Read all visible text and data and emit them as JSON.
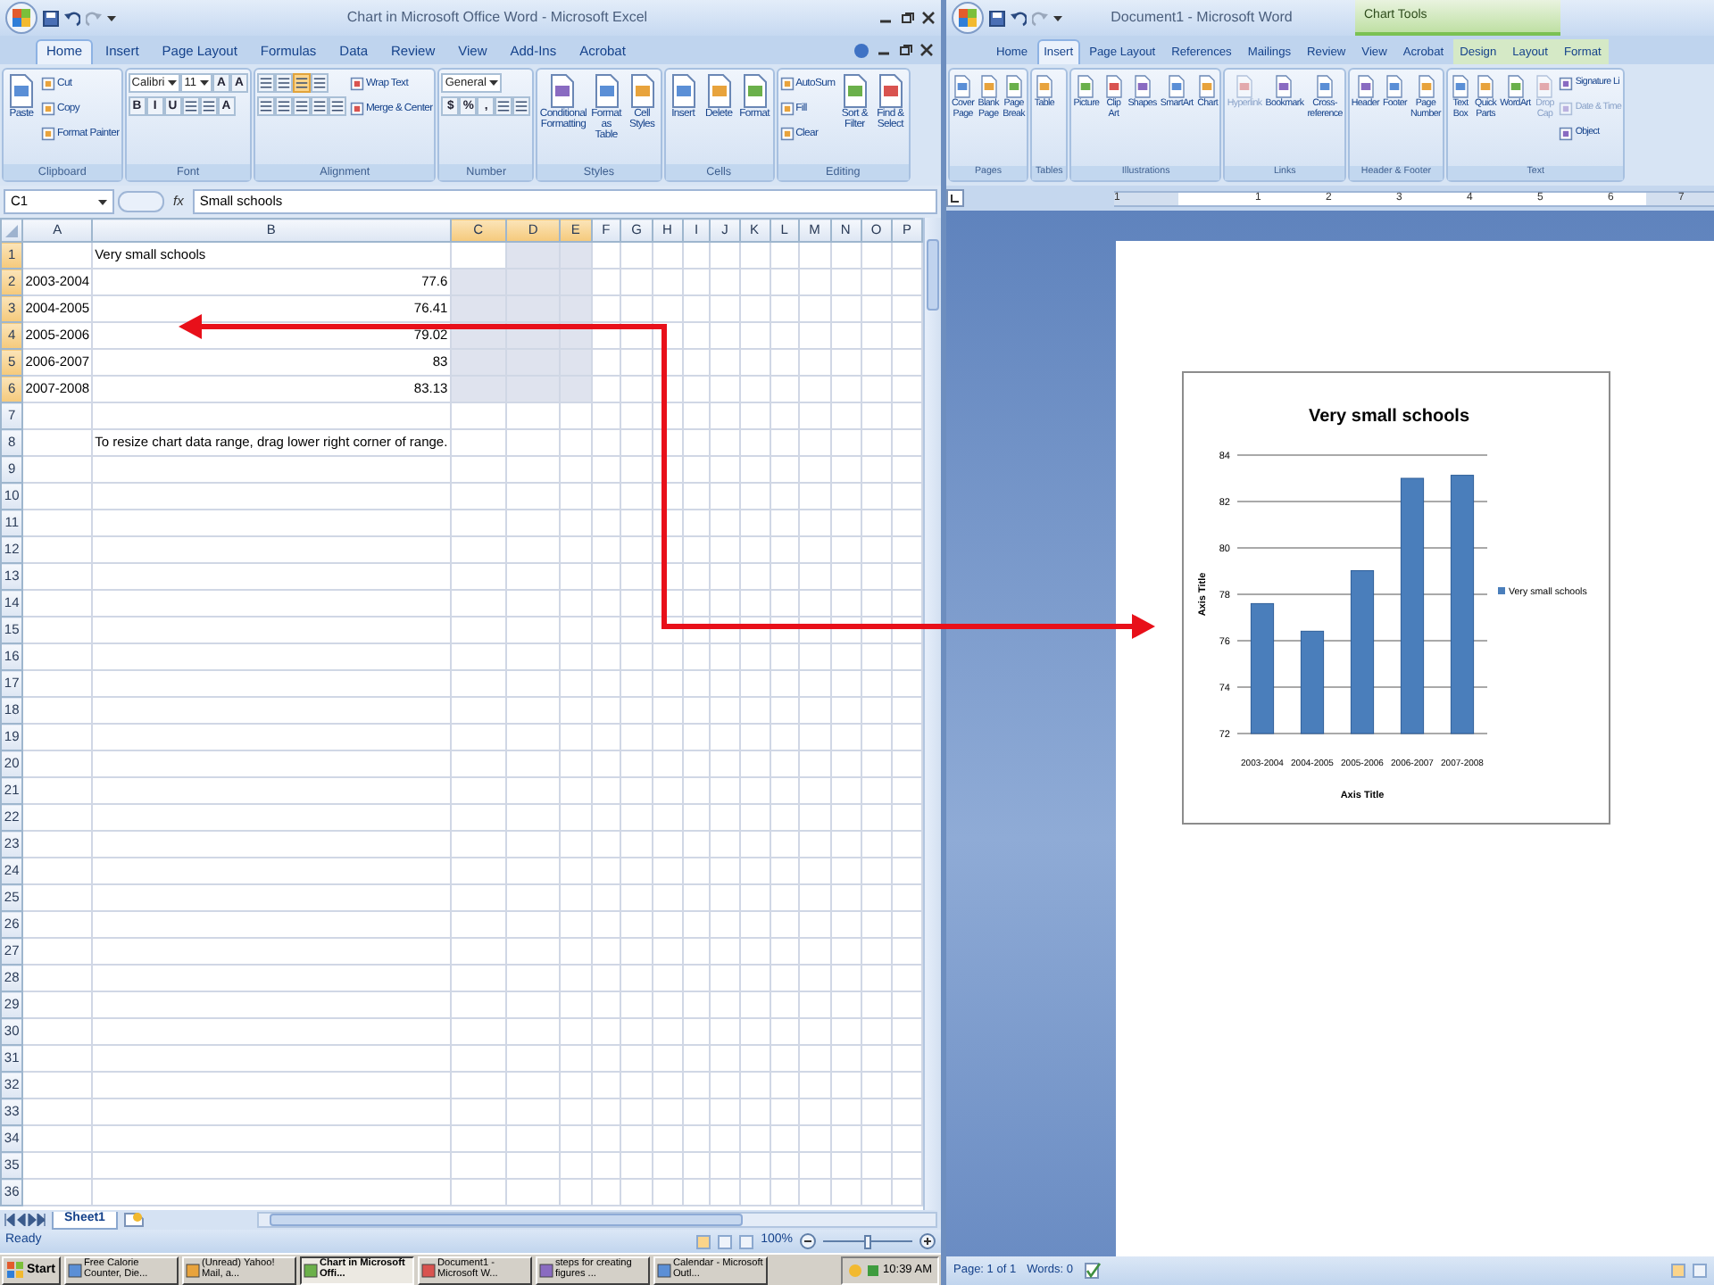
{
  "excel": {
    "title": "Chart in Microsoft Office Word - Microsoft Excel",
    "tabs": [
      {
        "label": "Home",
        "selected": true
      },
      {
        "label": "Insert",
        "selected": false
      },
      {
        "label": "Page Layout",
        "selected": false
      },
      {
        "label": "Formulas",
        "selected": false
      },
      {
        "label": "Data",
        "selected": false
      },
      {
        "label": "Review",
        "selected": false
      },
      {
        "label": "View",
        "selected": false
      },
      {
        "label": "Add-Ins",
        "selected": false
      },
      {
        "label": "Acrobat",
        "selected": false
      }
    ],
    "ribbon": [
      {
        "label": "Clipboard",
        "columns": [
          {
            "rows": [
              {
                "items": [
                  {
                    "kind": "large",
                    "label": "Paste"
                  }
                ]
              }
            ]
          },
          {
            "rows": [
              {
                "items": [
                  {
                    "kind": "small",
                    "label": "Cut"
                  }
                ]
              },
              {
                "items": [
                  {
                    "kind": "small",
                    "label": "Copy"
                  }
                ]
              },
              {
                "items": [
                  {
                    "kind": "small",
                    "label": "Format Painter"
                  }
                ]
              }
            ]
          }
        ]
      },
      {
        "label": "Font",
        "columns": [
          {
            "rows": [
              {
                "items": [
                  {
                    "kind": "combo",
                    "value": "Calibri"
                  },
                  {
                    "kind": "combo",
                    "value": "11"
                  },
                  {
                    "kind": "glyph",
                    "label": "A"
                  },
                  {
                    "kind": "glyph",
                    "label": "A"
                  }
                ]
              },
              {
                "items": [
                  {
                    "kind": "glyph",
                    "label": "B"
                  },
                  {
                    "kind": "glyph",
                    "label": "I"
                  },
                  {
                    "kind": "glyph",
                    "label": "U"
                  },
                  {
                    "kind": "icon",
                    "on": false
                  },
                  {
                    "kind": "icon",
                    "on": false
                  },
                  {
                    "kind": "glyph",
                    "label": "A"
                  }
                ]
              }
            ]
          }
        ]
      },
      {
        "label": "Alignment",
        "columns": [
          {
            "rows": [
              {
                "items": [
                  {
                    "kind": "icon",
                    "on": false
                  },
                  {
                    "kind": "icon",
                    "on": false
                  },
                  {
                    "kind": "icon",
                    "on": true
                  },
                  {
                    "kind": "icon",
                    "on": false
                  }
                ]
              },
              {
                "items": [
                  {
                    "kind": "icon",
                    "on": false
                  },
                  {
                    "kind": "icon",
                    "on": false
                  },
                  {
                    "kind": "icon",
                    "on": false
                  },
                  {
                    "kind": "icon",
                    "on": false
                  },
                  {
                    "kind": "icon",
                    "on": false
                  }
                ]
              }
            ]
          },
          {
            "rows": [
              {
                "items": [
                  {
                    "kind": "small",
                    "label": "Wrap Text"
                  }
                ]
              },
              {
                "items": [
                  {
                    "kind": "small",
                    "label": "Merge & Center"
                  }
                ]
              }
            ]
          }
        ]
      },
      {
        "label": "Number",
        "columns": [
          {
            "rows": [
              {
                "items": [
                  {
                    "kind": "combo",
                    "value": "General"
                  }
                ]
              },
              {
                "items": [
                  {
                    "kind": "glyph",
                    "label": "$"
                  },
                  {
                    "kind": "glyph",
                    "label": "%"
                  },
                  {
                    "kind": "glyph",
                    "label": ","
                  },
                  {
                    "kind": "icon",
                    "on": false
                  },
                  {
                    "kind": "icon",
                    "on": false
                  }
                ]
              }
            ]
          }
        ]
      },
      {
        "label": "Styles",
        "columns": [
          {
            "rows": [
              {
                "items": [
                  {
                    "kind": "large",
                    "label": "Conditional Formatting"
                  }
                ]
              }
            ]
          },
          {
            "rows": [
              {
                "items": [
                  {
                    "kind": "large",
                    "label": "Format as Table"
                  }
                ]
              }
            ]
          },
          {
            "rows": [
              {
                "items": [
                  {
                    "kind": "large",
                    "label": "Cell Styles"
                  }
                ]
              }
            ]
          }
        ]
      },
      {
        "label": "Cells",
        "columns": [
          {
            "rows": [
              {
                "items": [
                  {
                    "kind": "large",
                    "label": "Insert"
                  }
                ]
              }
            ]
          },
          {
            "rows": [
              {
                "items": [
                  {
                    "kind": "large",
                    "label": "Delete"
                  }
                ]
              }
            ]
          },
          {
            "rows": [
              {
                "items": [
                  {
                    "kind": "large",
                    "label": "Format"
                  }
                ]
              }
            ]
          }
        ]
      },
      {
        "label": "Editing",
        "columns": [
          {
            "rows": [
              {
                "items": [
                  {
                    "kind": "small",
                    "label": "AutoSum"
                  }
                ]
              },
              {
                "items": [
                  {
                    "kind": "small",
                    "label": "Fill"
                  }
                ]
              },
              {
                "items": [
                  {
                    "kind": "small",
                    "label": "Clear"
                  }
                ]
              }
            ]
          },
          {
            "rows": [
              {
                "items": [
                  {
                    "kind": "large",
                    "label": "Sort & Filter"
                  }
                ]
              }
            ]
          },
          {
            "rows": [
              {
                "items": [
                  {
                    "kind": "large",
                    "label": "Find & Select"
                  }
                ]
              }
            ]
          }
        ]
      }
    ],
    "formula_bar": {
      "name_box": "C1",
      "function_label": "fx",
      "value": "Small schools"
    },
    "sheet": {
      "columns": [
        {
          "label": "A",
          "selected": false
        },
        {
          "label": "B",
          "selected": false
        },
        {
          "label": "C",
          "selected": true
        },
        {
          "label": "D",
          "selected": true
        },
        {
          "label": "E",
          "selected": true
        },
        {
          "label": "F",
          "selected": false
        },
        {
          "label": "G",
          "selected": false
        },
        {
          "label": "H",
          "selected": false
        },
        {
          "label": "I",
          "selected": false
        },
        {
          "label": "J",
          "selected": false
        },
        {
          "label": "K",
          "selected": false
        },
        {
          "label": "L",
          "selected": false
        },
        {
          "label": "M",
          "selected": false
        },
        {
          "label": "N",
          "selected": false
        },
        {
          "label": "O",
          "selected": false
        },
        {
          "label": "P",
          "selected": false
        }
      ],
      "rows": [
        {
          "label": "1",
          "selected": true,
          "cells": [
            null,
            {
              "kind": "text",
              "text": "Very small schools"
            }
          ]
        },
        {
          "label": "2",
          "selected": true,
          "cells": [
            {
              "kind": "text",
              "text": "2003-2004"
            },
            {
              "kind": "number",
              "text": "77.6"
            }
          ]
        },
        {
          "label": "3",
          "selected": true,
          "cells": [
            {
              "kind": "text",
              "text": "2004-2005"
            },
            {
              "kind": "number",
              "text": "76.41"
            }
          ]
        },
        {
          "label": "4",
          "selected": true,
          "cells": [
            {
              "kind": "text",
              "text": "2005-2006"
            },
            {
              "kind": "number",
              "text": "79.02"
            }
          ]
        },
        {
          "label": "5",
          "selected": true,
          "cells": [
            {
              "kind": "text",
              "text": "2006-2007"
            },
            {
              "kind": "number",
              "text": "83"
            }
          ]
        },
        {
          "label": "6",
          "selected": true,
          "cells": [
            {
              "kind": "text",
              "text": "2007-2008"
            },
            {
              "kind": "number",
              "text": "83.13"
            }
          ]
        },
        {
          "label": "7",
          "selected": false
        },
        {
          "label": "8",
          "selected": false,
          "cells": [
            null,
            {
              "kind": "text",
              "text": "To resize chart data range, drag lower right corner of range."
            }
          ]
        },
        {
          "label": "9",
          "selected": false
        },
        {
          "label": "10",
          "selected": false
        },
        {
          "label": "11",
          "selected": false
        },
        {
          "label": "12",
          "selected": false
        },
        {
          "label": "13",
          "selected": false
        },
        {
          "label": "14",
          "selected": false
        },
        {
          "label": "15",
          "selected": false
        },
        {
          "label": "16",
          "selected": false
        },
        {
          "label": "17",
          "selected": false
        },
        {
          "label": "18",
          "selected": false
        },
        {
          "label": "19",
          "selected": false
        },
        {
          "label": "20",
          "selected": false
        },
        {
          "label": "21",
          "selected": false
        },
        {
          "label": "22",
          "selected": false
        },
        {
          "label": "23",
          "selected": false
        },
        {
          "label": "24",
          "selected": false
        },
        {
          "label": "25",
          "selected": false
        },
        {
          "label": "26",
          "selected": false
        },
        {
          "label": "27",
          "selected": false
        },
        {
          "label": "28",
          "selected": false
        },
        {
          "label": "29",
          "selected": false
        },
        {
          "label": "30",
          "selected": false
        },
        {
          "label": "31",
          "selected": false
        },
        {
          "label": "32",
          "selected": false
        },
        {
          "label": "33",
          "selected": false
        },
        {
          "label": "34",
          "selected": false
        },
        {
          "label": "35",
          "selected": false
        },
        {
          "label": "36",
          "selected": false
        }
      ]
    },
    "sheet_tabs": [
      {
        "label": "Sheet1",
        "selected": true
      }
    ],
    "status_bar": {
      "text": "Ready",
      "zoom": "100%",
      "zoom_slider": {
        "level": 0.5
      }
    }
  },
  "taskbar": {
    "start": "Start",
    "items": [
      {
        "label": "Free Calorie Counter, Die...",
        "selected": false
      },
      {
        "label": "(Unread) Yahoo! Mail, a...",
        "selected": false
      },
      {
        "label": "Chart in Microsoft Offi...",
        "selected": true
      },
      {
        "label": "Document1 - Microsoft W...",
        "selected": false
      },
      {
        "label": "steps for creating figures ...",
        "selected": false
      },
      {
        "label": "Calendar - Microsoft Outl...",
        "selected": false
      }
    ],
    "clock": "10:39 AM"
  },
  "word": {
    "title": "Document1 - Microsoft Word",
    "tabs": [
      {
        "label": "Home",
        "selected": false
      },
      {
        "label": "Insert",
        "selected": true
      },
      {
        "label": "Page Layout",
        "selected": false
      },
      {
        "label": "References",
        "selected": false
      },
      {
        "label": "Mailings",
        "selected": false
      },
      {
        "label": "Review",
        "selected": false
      },
      {
        "label": "View",
        "selected": false
      },
      {
        "label": "Acrobat",
        "selected": false
      }
    ],
    "chart_tools": {
      "label": "Chart Tools",
      "tabs": [
        {
          "label": "Design",
          "selected": false
        },
        {
          "label": "Layout",
          "selected": false
        },
        {
          "label": "Format",
          "selected": false
        }
      ]
    },
    "ribbon": [
      {
        "label": "Pages",
        "columns": [
          {
            "rows": [
              {
                "items": [
                  {
                    "kind": "large",
                    "label": "Cover Page",
                    "disabled": false
                  }
                ]
              }
            ]
          },
          {
            "rows": [
              {
                "items": [
                  {
                    "kind": "large",
                    "label": "Blank Page",
                    "disabled": false
                  }
                ]
              }
            ]
          },
          {
            "rows": [
              {
                "items": [
                  {
                    "kind": "large",
                    "label": "Page Break",
                    "disabled": false
                  }
                ]
              }
            ]
          }
        ]
      },
      {
        "label": "Tables",
        "columns": [
          {
            "rows": [
              {
                "items": [
                  {
                    "kind": "large",
                    "label": "Table",
                    "disabled": false
                  }
                ]
              }
            ]
          }
        ]
      },
      {
        "label": "Illustrations",
        "columns": [
          {
            "rows": [
              {
                "items": [
                  {
                    "kind": "large",
                    "label": "Picture",
                    "disabled": false
                  }
                ]
              }
            ]
          },
          {
            "rows": [
              {
                "items": [
                  {
                    "kind": "large",
                    "label": "Clip Art",
                    "disabled": false
                  }
                ]
              }
            ]
          },
          {
            "rows": [
              {
                "items": [
                  {
                    "kind": "large",
                    "label": "Shapes",
                    "disabled": false
                  }
                ]
              }
            ]
          },
          {
            "rows": [
              {
                "items": [
                  {
                    "kind": "large",
                    "label": "SmartArt",
                    "disabled": false
                  }
                ]
              }
            ]
          },
          {
            "rows": [
              {
                "items": [
                  {
                    "kind": "large",
                    "label": "Chart",
                    "disabled": false
                  }
                ]
              }
            ]
          }
        ]
      },
      {
        "label": "Links",
        "columns": [
          {
            "rows": [
              {
                "items": [
                  {
                    "kind": "large",
                    "label": "Hyperlink",
                    "disabled": true
                  }
                ]
              }
            ]
          },
          {
            "rows": [
              {
                "items": [
                  {
                    "kind": "large",
                    "label": "Bookmark",
                    "disabled": false
                  }
                ]
              }
            ]
          },
          {
            "rows": [
              {
                "items": [
                  {
                    "kind": "large",
                    "label": "Cross-reference",
                    "disabled": false
                  }
                ]
              }
            ]
          }
        ]
      },
      {
        "label": "Header & Footer",
        "columns": [
          {
            "rows": [
              {
                "items": [
                  {
                    "kind": "large",
                    "label": "Header",
                    "disabled": false
                  }
                ]
              }
            ]
          },
          {
            "rows": [
              {
                "items": [
                  {
                    "kind": "large",
                    "label": "Footer",
                    "disabled": false
                  }
                ]
              }
            ]
          },
          {
            "rows": [
              {
                "items": [
                  {
                    "kind": "large",
                    "label": "Page Number",
                    "disabled": false
                  }
                ]
              }
            ]
          }
        ]
      },
      {
        "label": "Text",
        "columns": [
          {
            "rows": [
              {
                "items": [
                  {
                    "kind": "large",
                    "label": "Text Box",
                    "disabled": false
                  }
                ]
              }
            ]
          },
          {
            "rows": [
              {
                "items": [
                  {
                    "kind": "large",
                    "label": "Quick Parts",
                    "disabled": false
                  }
                ]
              }
            ]
          },
          {
            "rows": [
              {
                "items": [
                  {
                    "kind": "large",
                    "label": "WordArt",
                    "disabled": false
                  }
                ]
              }
            ]
          },
          {
            "rows": [
              {
                "items": [
                  {
                    "kind": "large",
                    "label": "Drop Cap",
                    "disabled": true
                  }
                ]
              }
            ]
          },
          {
            "rows": [
              {
                "items": [
                  {
                    "kind": "small",
                    "label": "Signature Li",
                    "disabled": false
                  }
                ]
              },
              {
                "items": [
                  {
                    "kind": "small",
                    "label": "Date & Time",
                    "disabled": true
                  }
                ]
              },
              {
                "items": [
                  {
                    "kind": "small",
                    "label": "Object",
                    "disabled": false
                  }
                ]
              }
            ]
          }
        ]
      }
    ],
    "ruler": [
      "1",
      "1",
      "2",
      "3",
      "4",
      "5",
      "6",
      "7"
    ],
    "chart": {
      "chart_data": {
        "type": "bar",
        "title": "Very small schools",
        "xlabel": "Axis Title",
        "ylabel": "Axis Title",
        "categories": [
          "2003-2004",
          "2004-2005",
          "2005-2006",
          "2006-2007",
          "2007-2008"
        ],
        "series": [
          {
            "name": "Very small schools",
            "color": "#4a7ebb",
            "values": [
              77.6,
              76.41,
              79.02,
              83,
              83.13
            ]
          }
        ],
        "ylim": [
          72,
          84
        ],
        "yticks": [
          72,
          74,
          76,
          78,
          80,
          82,
          84
        ],
        "grid": true
      }
    },
    "status_bar": {
      "page": "Page: 1 of 1",
      "words": "Words: 0"
    }
  }
}
